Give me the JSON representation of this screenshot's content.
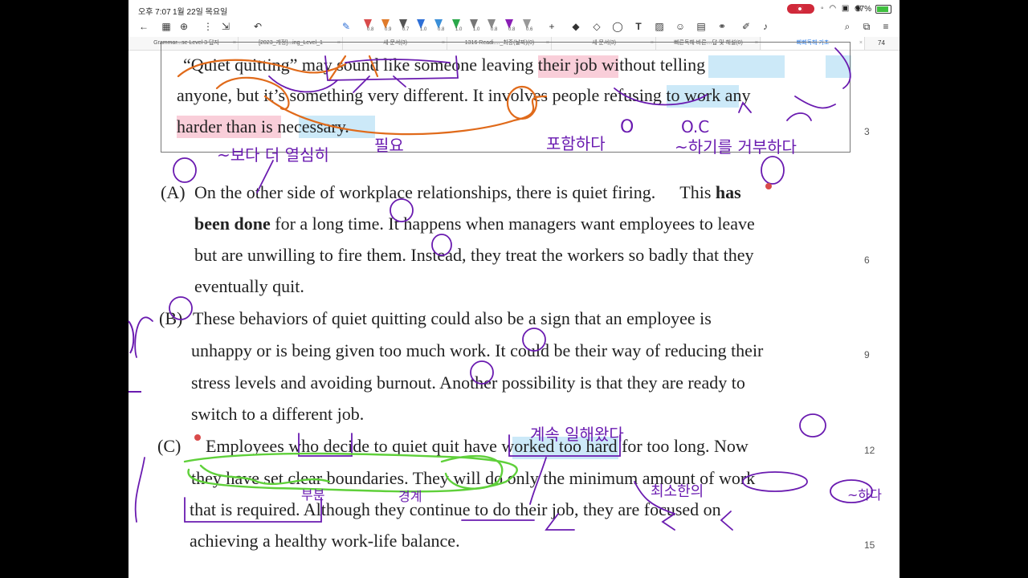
{
  "status": {
    "time": "오후 7:07",
    "date": "1월 22일 목요일",
    "battery": "97%"
  },
  "toolbar": {
    "pens": [
      {
        "size": "0.8",
        "color": "#d94b4b"
      },
      {
        "size": "0.9",
        "color": "#e07b2a"
      },
      {
        "size": "0.7",
        "color": "#555555"
      },
      {
        "size": "1.0",
        "color": "#2e6fd6"
      },
      {
        "size": "0.8",
        "color": "#3b8fd8"
      },
      {
        "size": "1.0",
        "color": "#2aa84a"
      },
      {
        "size": "1.0",
        "color": "#777777"
      },
      {
        "size": "0.8",
        "color": "#888888"
      },
      {
        "size": "0.8",
        "color": "#8a1fb5"
      },
      {
        "size": "0.6",
        "color": "#999999"
      }
    ],
    "zoom": "74"
  },
  "tabs": [
    {
      "label": "Grammar...se Level 3 답지",
      "active": false
    },
    {
      "label": "[2023_개정]...ing_Level_1",
      "active": false
    },
    {
      "label": "새 문서(3)",
      "active": false
    },
    {
      "label": "1316 Readi...._최종(날짜)(0)",
      "active": false
    },
    {
      "label": "새 문서(3)",
      "active": false
    },
    {
      "label": "빠른독해 바른…답 및 해설(0)",
      "active": false
    },
    {
      "label": "빠빠독해 기초",
      "active": true
    }
  ],
  "document": {
    "intro_lines": [
      "“Quiet quitting” may sound like someone leaving their job without telling",
      "anyone, but it’s something very different. It involves people refusing to work any",
      "harder than is necessary."
    ],
    "paragraphs": [
      {
        "label": "(A)",
        "lines": [
          "On the other side of workplace relationships, there is quiet firing.",
          "been done for a long time. It happens when managers want employees to leave",
          "but are unwilling to fire them. Instead, they treat the workers so badly that they",
          "eventually quit."
        ],
        "tail_normal": "This ",
        "tail_bold": "has",
        "bold_start": "been done"
      },
      {
        "label": "(B)",
        "lines": [
          "These behaviors of quiet quitting could also be a sign that an employee is",
          "unhappy or is being given too much work. It could be their way of reducing their",
          "stress levels and avoiding burnout. Another possibility is that they are ready to",
          "switch to a different job."
        ]
      },
      {
        "label": "(C)",
        "lines": [
          "Employees who decide to quiet quit have worked too hard for too long. Now",
          "they have set clear boundaries. They will do only the minimum amount of work",
          "that is required. Although they continue to do their job, they are focused on",
          "achieving a healthy work-life balance."
        ]
      }
    ],
    "line_numbers": [
      "3",
      "6",
      "9",
      "12",
      "15"
    ],
    "annotations": {
      "korean_1": "~보다 더 열심히",
      "korean_2": "필요",
      "korean_3": "포함하다",
      "korean_4": "~하기를 거부하다",
      "korean_5": "계속 일해왔다",
      "korean_6": "부분",
      "korean_7": "경계",
      "korean_8": "최소한의",
      "korean_9": "~하다",
      "circle_o": "O",
      "circle_oc": "O.C"
    }
  },
  "colors": {
    "pen_purple": "#7b1fa2",
    "pen_orange": "#e06a1a",
    "pen_green": "#5fd03a",
    "pen_blue": "#3a3aa8",
    "highlight_pink": "#f6b9c9",
    "highlight_blue": "#bfe3f6"
  }
}
